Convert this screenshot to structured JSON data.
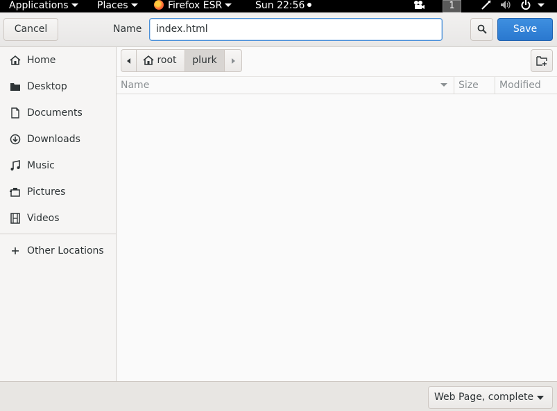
{
  "topbar": {
    "applications": "Applications",
    "places": "Places",
    "browser": "Firefox ESR",
    "clock": "Sun 22:56",
    "workspace": "1"
  },
  "header": {
    "cancel_label": "Cancel",
    "name_label": "Name",
    "filename": "index.html",
    "save_label": "Save"
  },
  "sidebar": {
    "items": [
      {
        "label": "Home",
        "icon": "home-icon"
      },
      {
        "label": "Desktop",
        "icon": "desktop-folder-icon"
      },
      {
        "label": "Documents",
        "icon": "document-icon"
      },
      {
        "label": "Downloads",
        "icon": "download-icon"
      },
      {
        "label": "Music",
        "icon": "music-icon"
      },
      {
        "label": "Pictures",
        "icon": "camera-icon"
      },
      {
        "label": "Videos",
        "icon": "film-icon"
      }
    ],
    "other_locations": "Other Locations"
  },
  "pathbar": {
    "segments": [
      "root",
      "plurk"
    ],
    "active": "plurk"
  },
  "file_list": {
    "columns": [
      "Name",
      "Size",
      "Modified"
    ],
    "sort_column": "Name",
    "rows": []
  },
  "footer": {
    "file_type": "Web Page, complete"
  },
  "colors": {
    "accent": "#3584e4",
    "topbar": "#000000"
  }
}
